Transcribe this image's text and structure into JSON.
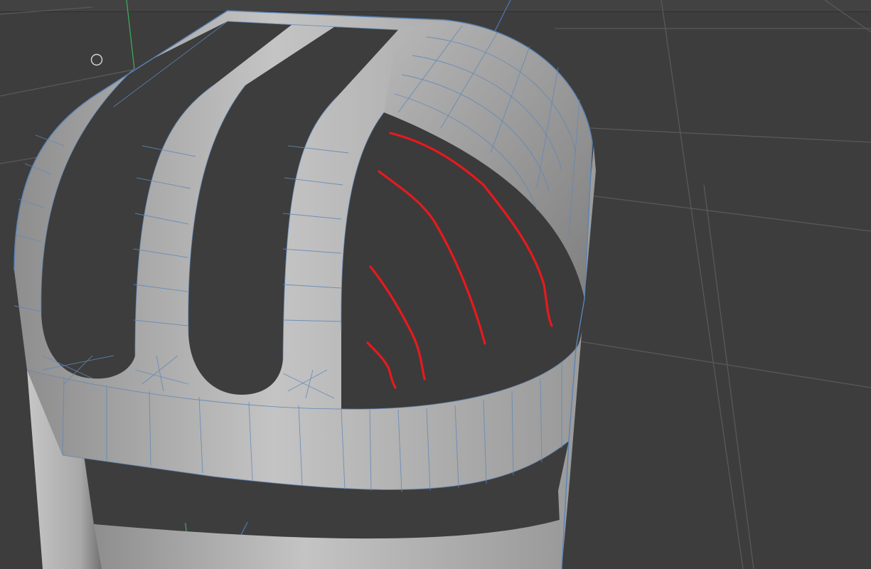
{
  "viewport": {
    "background": "#3d3d3d",
    "grid_color": "#595959",
    "axis_y_color": "#3fae5a",
    "axis_z_color": "#4d78c0",
    "mesh_color": "#b4b4b4",
    "wire_color": "#5f87b8",
    "annotation_color": "#e8191d"
  },
  "cursor": {
    "icon": "circle-brush-cursor"
  },
  "annotation": {
    "stroke_count": 5
  }
}
